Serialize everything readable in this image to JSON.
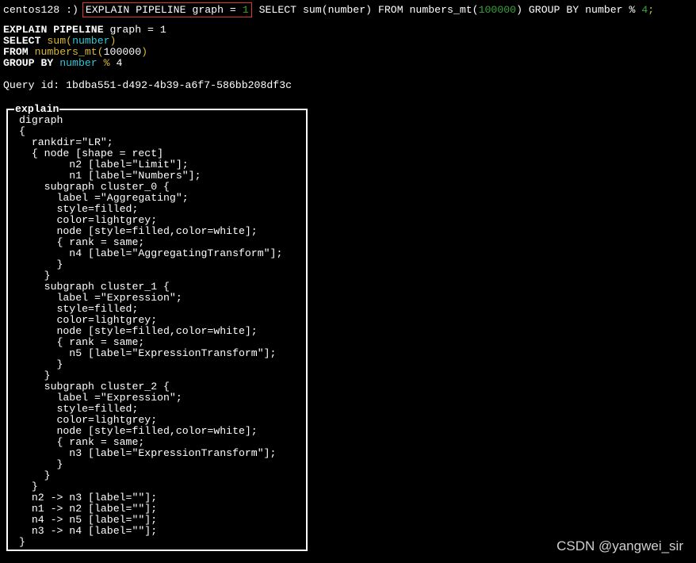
{
  "prompt": {
    "host": "centos128 :)",
    "cmd_hl_a": "EXPLAIN PIPELINE graph = ",
    "cmd_hl_b": "1",
    "cmd_rest_a": " SELECT sum(number) FROM numbers_mt(",
    "cmd_rest_num": "100000",
    "cmd_rest_b": ") GROUP BY number % ",
    "cmd_rest_c": "4",
    "cmd_rest_d": ";"
  },
  "echo": {
    "l1_kw": "EXPLAIN PIPELINE",
    "l1_rest": " graph = 1",
    "l2_kw": "SELECT",
    "l2_fn": " sum(",
    "l2_arg": "number",
    "l2_end": ")",
    "l3_kw": "FROM",
    "l3_fn": " numbers_mt(",
    "l3_arg": "100000",
    "l3_end": ")",
    "l4_kw": "GROUP BY",
    "l4_arg": " number",
    "l4_op": " %",
    "l4_val": " 4"
  },
  "query_id": "Query id: 1bdba551-d492-4b39-a6f7-586bb208df3c",
  "result": {
    "column": "explain",
    "lines": [
      "digraph",
      "{",
      "  rankdir=\"LR\";",
      "  { node [shape = rect]",
      "        n2 [label=\"Limit\"];",
      "        n1 [label=\"Numbers\"];",
      "    subgraph cluster_0 {",
      "      label =\"Aggregating\";",
      "      style=filled;",
      "      color=lightgrey;",
      "      node [style=filled,color=white];",
      "      { rank = same;",
      "        n4 [label=\"AggregatingTransform\"];",
      "      }",
      "    }",
      "    subgraph cluster_1 {",
      "      label =\"Expression\";",
      "      style=filled;",
      "      color=lightgrey;",
      "      node [style=filled,color=white];",
      "      { rank = same;",
      "        n5 [label=\"ExpressionTransform\"];",
      "      }",
      "    }",
      "    subgraph cluster_2 {",
      "      label =\"Expression\";",
      "      style=filled;",
      "      color=lightgrey;",
      "      node [style=filled,color=white];",
      "      { rank = same;",
      "        n3 [label=\"ExpressionTransform\"];",
      "      }",
      "    }",
      "  }",
      "  n2 -> n3 [label=\"\"];",
      "  n1 -> n2 [label=\"\"];",
      "  n4 -> n5 [label=\"\"];",
      "  n3 -> n4 [label=\"\"];",
      "}"
    ]
  },
  "watermark": "CSDN @yangwei_sir"
}
